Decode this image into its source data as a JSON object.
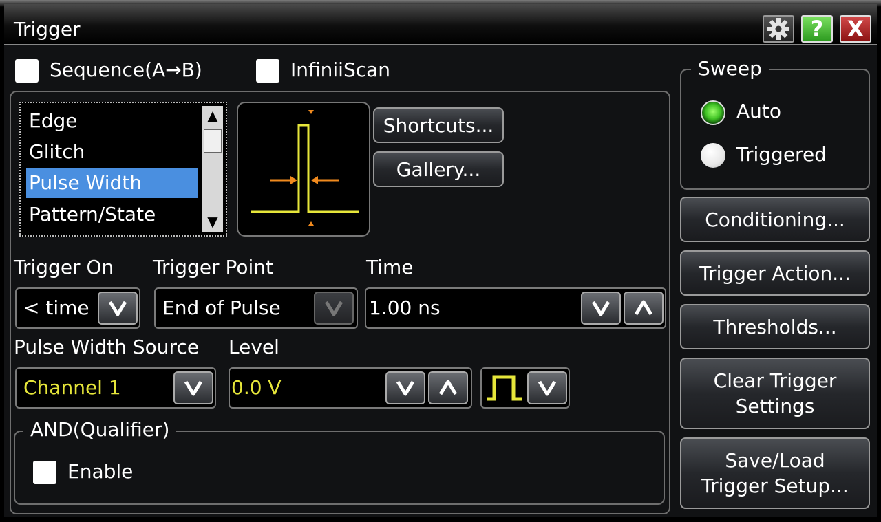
{
  "window": {
    "title": "Trigger"
  },
  "titlebar_buttons": [
    {
      "name": "settings",
      "icon": "gear-icon"
    },
    {
      "name": "help",
      "label": "?",
      "icon": "help-icon",
      "color": "#3fbf2b"
    },
    {
      "name": "close",
      "label": "X",
      "icon": "close-icon",
      "color": "#b42020"
    }
  ],
  "top_options": {
    "sequence_label": "Sequence(A→B)",
    "sequence_checked": false,
    "infiniiscan_label": "InfiniiScan",
    "infiniiscan_checked": false
  },
  "trigger_types": {
    "items": [
      "Edge",
      "Glitch",
      "Pulse Width",
      "Pattern/State"
    ],
    "selected": "Pulse Width",
    "scroll_up": "▲",
    "scroll_down": "▼"
  },
  "buttons": {
    "shortcuts": "Shortcuts...",
    "gallery": "Gallery..."
  },
  "fields": {
    "trigger_on_label": "Trigger On",
    "trigger_on_value": "< time",
    "trigger_point_label": "Trigger Point",
    "trigger_point_value": "End of Pulse",
    "time_label": "Time",
    "time_value": "1.00 ns",
    "source_label": "Pulse Width Source",
    "source_value": "Channel 1",
    "level_label": "Level",
    "level_value": "0.0 V",
    "polarity_icon": "positive-pulse-icon"
  },
  "qualifier": {
    "group_label": "AND(Qualifier)",
    "enable_label": "Enable",
    "enabled": false
  },
  "sweep": {
    "group_label": "Sweep",
    "options": [
      "Auto",
      "Triggered"
    ],
    "selected": "Auto"
  },
  "side_buttons": {
    "conditioning": "Conditioning...",
    "trigger_action": "Trigger Action...",
    "thresholds": "Thresholds...",
    "clear_line1": "Clear Trigger",
    "clear_line2": "Settings",
    "save_line1": "Save/Load",
    "save_line2": "Trigger Setup..."
  },
  "colors": {
    "selection": "#4a8fe0",
    "waveform": "#e6e63a",
    "marker": "#f08a1e",
    "radio_on": "#3fc224"
  }
}
